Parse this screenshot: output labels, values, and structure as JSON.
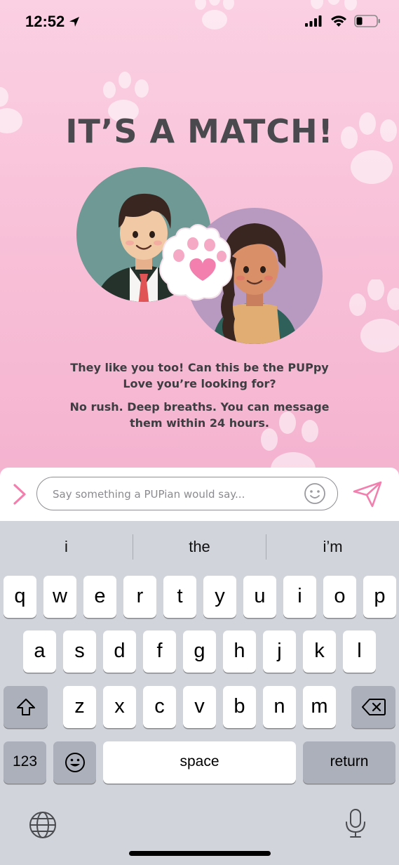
{
  "status_bar": {
    "time": "12:52"
  },
  "match": {
    "title": "IT’S A MATCH!",
    "message_line1": "They like you too! Can this be the PUPpy",
    "message_line2": "Love you’re looking for?",
    "subtext_line1": "No rush. Deep breaths. You can message",
    "subtext_line2": "them within 24 hours."
  },
  "composer": {
    "placeholder": "Say something a PUPian would say..."
  },
  "keyboard": {
    "suggestions": [
      "i",
      "the",
      "i’m"
    ],
    "row1": [
      "q",
      "w",
      "e",
      "r",
      "t",
      "y",
      "u",
      "i",
      "o",
      "p"
    ],
    "row2": [
      "a",
      "s",
      "d",
      "f",
      "g",
      "h",
      "j",
      "k",
      "l"
    ],
    "row3": [
      "z",
      "x",
      "c",
      "v",
      "b",
      "n",
      "m"
    ],
    "numbers_label": "123",
    "space_label": "space",
    "return_label": "return"
  },
  "colors": {
    "accent_pink": "#f27fae",
    "title_gray": "#4a4a4e"
  }
}
